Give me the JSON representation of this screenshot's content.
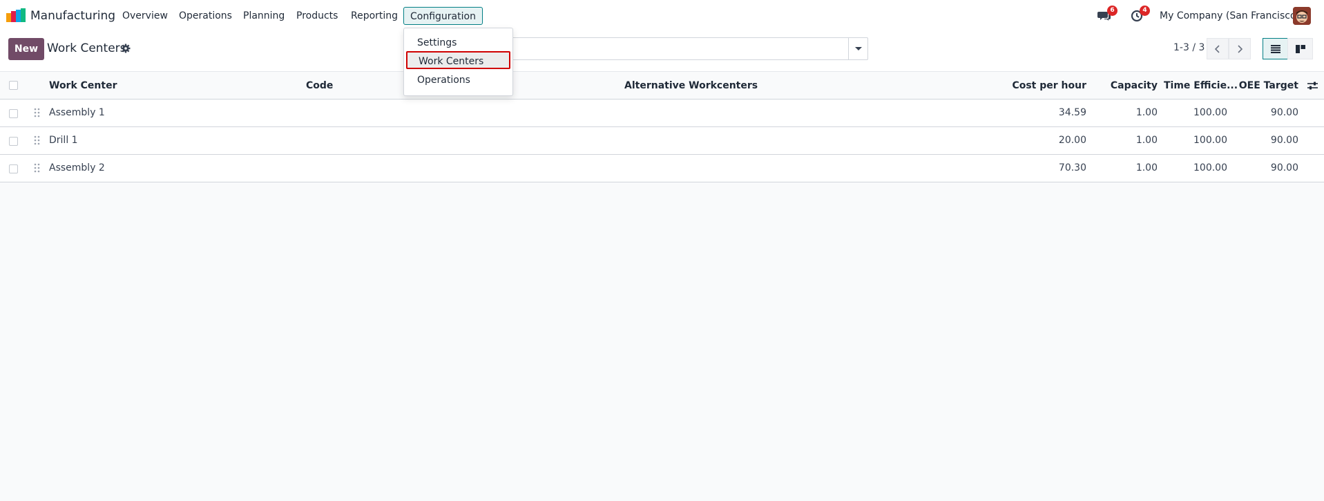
{
  "navbar": {
    "app_name": "Manufacturing",
    "menu": [
      "Overview",
      "Operations",
      "Planning",
      "Products",
      "Reporting",
      "Configuration"
    ],
    "active_menu": "Configuration",
    "messages_badge": "6",
    "activities_badge": "4",
    "company": "My Company (San Francisco)"
  },
  "control_panel": {
    "new_label": "New",
    "breadcrumb": "Work Centers",
    "pager": "1-3 / 3"
  },
  "dropdown": {
    "items": [
      "Settings",
      "Work Centers",
      "Operations"
    ],
    "highlighted": "Work Centers"
  },
  "table": {
    "columns": {
      "work_center": "Work Center",
      "code": "Code",
      "alternative": "Alternative Workcenters",
      "cost": "Cost per hour",
      "capacity": "Capacity",
      "efficiency": "Time Efficie...",
      "oee": "OEE Target"
    },
    "rows": [
      {
        "name": "Assembly 1",
        "code": "",
        "alternative": "",
        "cost": "34.59",
        "capacity": "1.00",
        "efficiency": "100.00",
        "oee": "90.00"
      },
      {
        "name": "Drill 1",
        "code": "",
        "alternative": "",
        "cost": "20.00",
        "capacity": "1.00",
        "efficiency": "100.00",
        "oee": "90.00"
      },
      {
        "name": "Assembly 2",
        "code": "",
        "alternative": "",
        "cost": "70.30",
        "capacity": "1.00",
        "efficiency": "100.00",
        "oee": "90.00"
      }
    ]
  },
  "colors": {
    "brand": "#714b67",
    "accent": "#017e84",
    "badge": "#dc2626",
    "highlight_border": "#d00000"
  }
}
